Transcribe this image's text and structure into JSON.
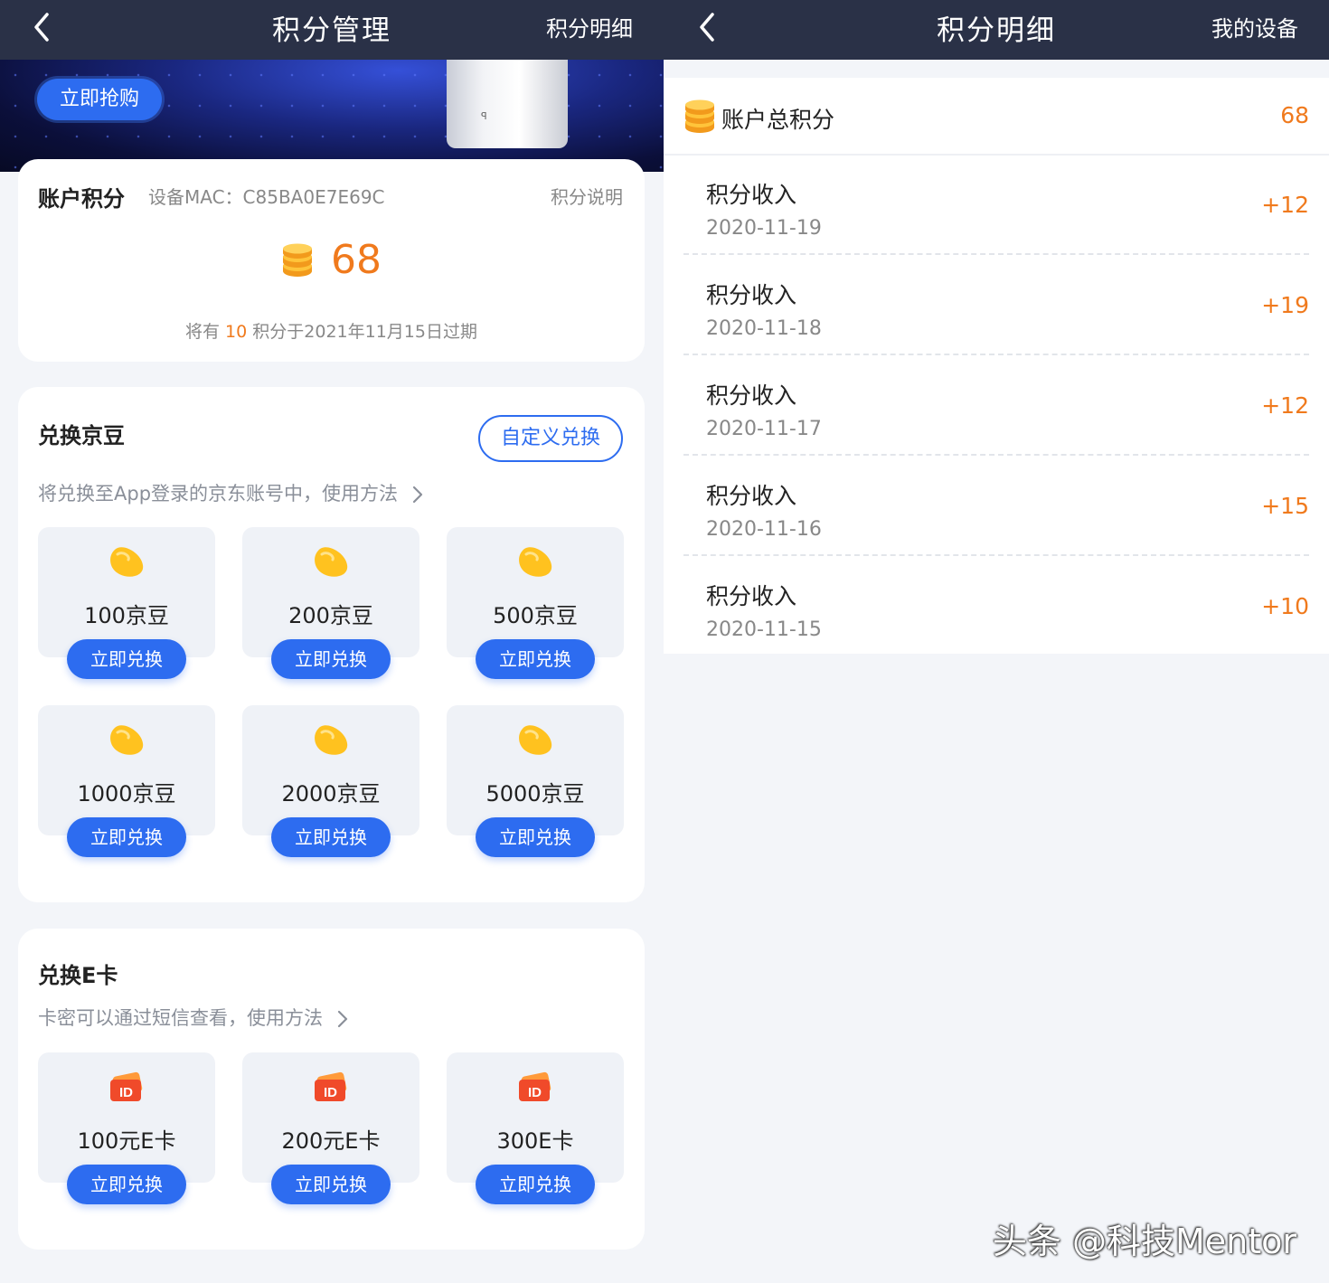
{
  "left": {
    "header": {
      "title": "积分管理",
      "action": "积分明细"
    },
    "banner": {
      "buy_label": "立即抢购"
    },
    "account": {
      "label": "账户积分",
      "mac": "设备MAC：C85BA0E7E69C",
      "explain": "积分说明",
      "points": "68",
      "expire_pre": "将有",
      "expire_amount": "10",
      "expire_post": "积分于2021年11月15日过期"
    },
    "beans": {
      "title": "兑换京豆",
      "custom_label": "自定义兑换",
      "subtitle": "将兑换至App登录的京东账号中，使用方法",
      "items": [
        {
          "name": "100京豆",
          "button": "立即兑换"
        },
        {
          "name": "200京豆",
          "button": "立即兑换"
        },
        {
          "name": "500京豆",
          "button": "立即兑换"
        },
        {
          "name": "1000京豆",
          "button": "立即兑换"
        },
        {
          "name": "2000京豆",
          "button": "立即兑换"
        },
        {
          "name": "5000京豆",
          "button": "立即兑换"
        }
      ]
    },
    "ecard": {
      "title": "兑换E卡",
      "subtitle": "卡密可以通过短信查看，使用方法",
      "items": [
        {
          "name": "100元E卡",
          "button": "立即兑换"
        },
        {
          "name": "200元E卡",
          "button": "立即兑换"
        },
        {
          "name": "300E卡",
          "button": "立即兑换"
        }
      ]
    }
  },
  "right": {
    "header": {
      "title": "积分明细",
      "action": "我的设备"
    },
    "total": {
      "label": "账户总积分",
      "value": "68"
    },
    "records": [
      {
        "title": "积分收入",
        "date": "2020-11-19",
        "value": "+12"
      },
      {
        "title": "积分收入",
        "date": "2020-11-18",
        "value": "+19"
      },
      {
        "title": "积分收入",
        "date": "2020-11-17",
        "value": "+12"
      },
      {
        "title": "积分收入",
        "date": "2020-11-16",
        "value": "+15"
      },
      {
        "title": "积分收入",
        "date": "2020-11-15",
        "value": "+10"
      }
    ]
  },
  "watermark": "头条 @科技Mentor",
  "colors": {
    "header": "#2a3147",
    "accent": "#2d6cf0",
    "points": "#f07a1d"
  }
}
